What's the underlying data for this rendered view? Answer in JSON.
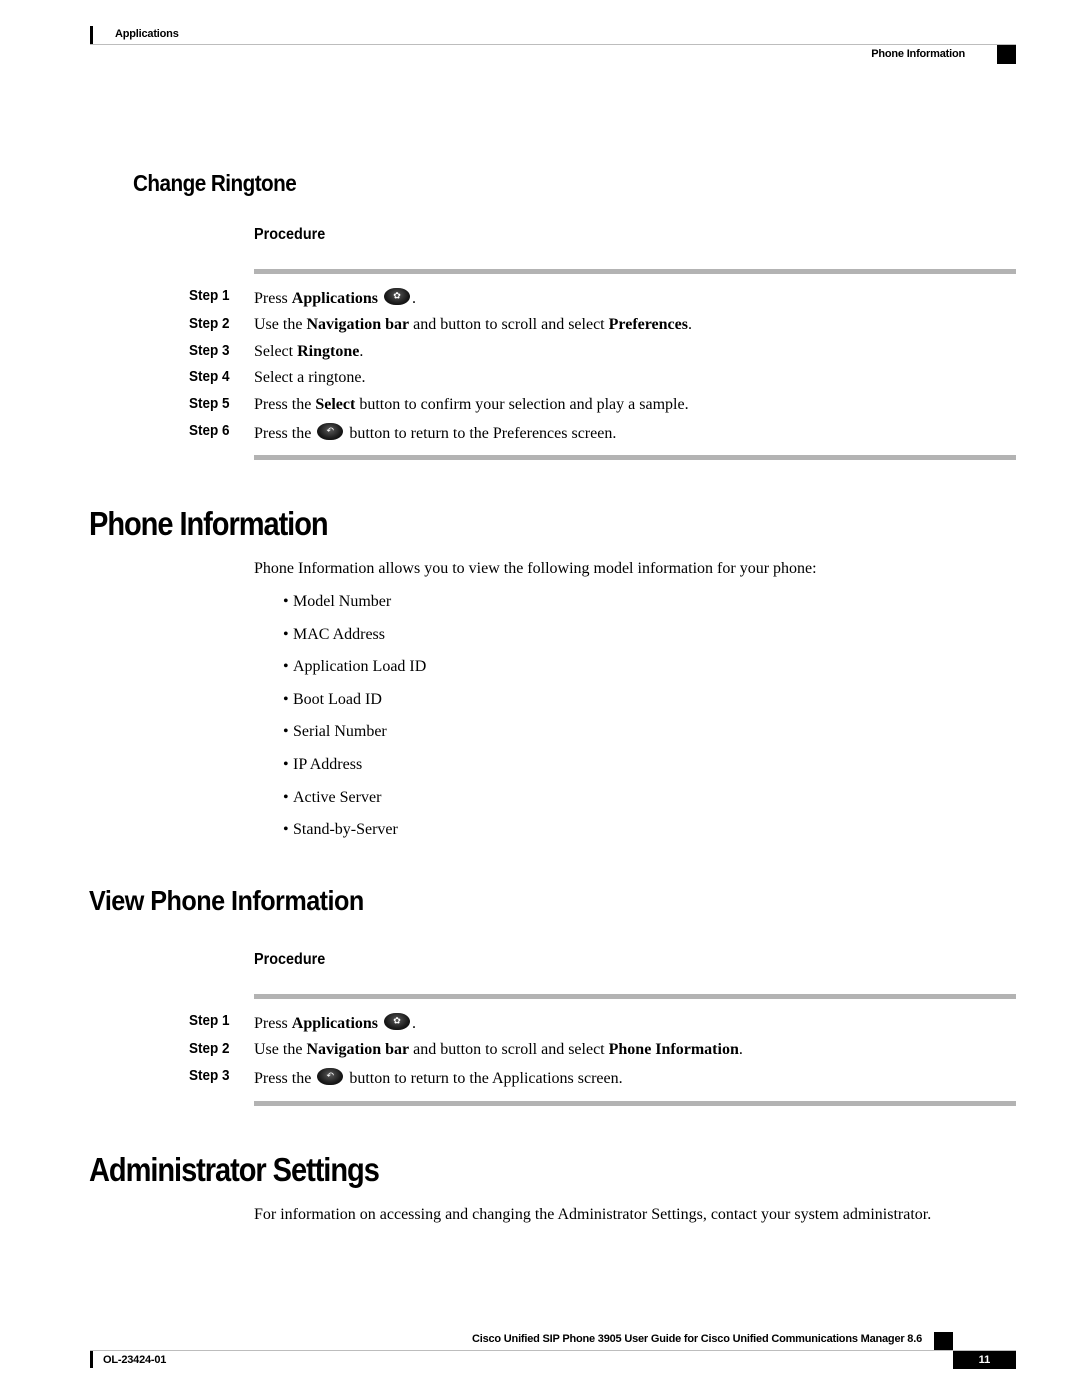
{
  "header": {
    "chapter": "Applications",
    "section": "Phone Information"
  },
  "change_ringtone": {
    "title": "Change Ringtone",
    "procedure_label": "Procedure",
    "steps": [
      {
        "label": "Step 1",
        "pre": "Press ",
        "bold1": "Applications",
        "icon": "applications-button-icon",
        "post": "."
      },
      {
        "label": "Step 2",
        "pre": "Use the ",
        "bold1": "Navigation bar",
        "mid": " and button to scroll and select ",
        "bold2": "Preferences",
        "post": "."
      },
      {
        "label": "Step 3",
        "pre": "Select ",
        "bold1": "Ringtone",
        "post": "."
      },
      {
        "label": "Step 4",
        "pre": "Select a ringtone."
      },
      {
        "label": "Step 5",
        "pre": "Press the ",
        "bold1": "Select",
        "mid": " button to confirm your selection and play a sample."
      },
      {
        "label": "Step 6",
        "pre": "Press the ",
        "icon": "back-button-icon",
        "post": " button to return to the Preferences screen."
      }
    ]
  },
  "phone_information": {
    "title": "Phone Information",
    "intro": "Phone Information allows you to view the following model information for your phone:",
    "bullet_char": "•",
    "items": [
      "Model Number",
      "MAC Address",
      "Application Load ID",
      "Boot Load ID",
      "Serial Number",
      "IP Address",
      "Active Server",
      "Stand-by-Server"
    ]
  },
  "view_phone_information": {
    "title": "View Phone Information",
    "procedure_label": "Procedure",
    "steps": [
      {
        "label": "Step 1",
        "pre": "Press ",
        "bold1": "Applications",
        "icon": "applications-button-icon",
        "post": "."
      },
      {
        "label": "Step 2",
        "pre": "Use the ",
        "bold1": "Navigation bar",
        "mid": " and button to scroll and select ",
        "bold2": "Phone Information",
        "post": "."
      },
      {
        "label": "Step 3",
        "pre": "Press the ",
        "icon": "back-button-icon",
        "post": " button to return to the Applications screen."
      }
    ]
  },
  "administrator_settings": {
    "title": "Administrator Settings",
    "text": "For information on accessing and changing the Administrator Settings, contact your system administrator."
  },
  "footer": {
    "guide_title": "Cisco Unified SIP Phone 3905 User Guide for Cisco Unified Communications Manager 8.6",
    "doc_id": "OL-23424-01",
    "page_number": "11"
  },
  "icons": {
    "applications_glyph": "✿",
    "back_glyph": "↶"
  }
}
